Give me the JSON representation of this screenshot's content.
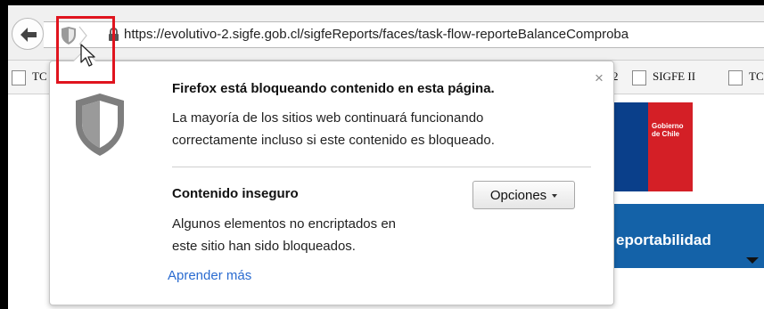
{
  "navbar": {
    "url": "https://evolutivo-2.sigfe.gob.cl/sigfeReports/faces/task-flow-reporteBalanceComproba"
  },
  "bookmarks": [
    {
      "label": "TC"
    },
    {
      "label": "2"
    },
    {
      "label": "SIGFE II"
    },
    {
      "label": "TC"
    }
  ],
  "page": {
    "logo_text": "Gobierno de Chile",
    "report_label": "eportabilidad"
  },
  "popup": {
    "close_label": "×",
    "title": "Firefox está bloqueando contenido en esta página.",
    "line1": "La mayoría de los sitios web continuará funcionando",
    "line2": "correctamente incluso si este contenido es bloqueado.",
    "insecure_title": "Contenido inseguro",
    "options_label": "Opciones",
    "insecure_line1": "Algunos elementos no encriptados en",
    "insecure_line2": "este sitio han sido bloqueados.",
    "learn_more": "Aprender más"
  },
  "icons": {
    "back": "back-arrow-icon",
    "identity": "shield-icon",
    "lock": "lock-icon",
    "big_shield": "shield-icon",
    "cursor": "cursor-icon"
  },
  "colors": {
    "annotation_red": "#e0141e",
    "link_blue": "#2a6bd0",
    "report_blue": "#1462a8",
    "logo_blue": "#0a3f8a",
    "logo_red": "#d41f26"
  }
}
